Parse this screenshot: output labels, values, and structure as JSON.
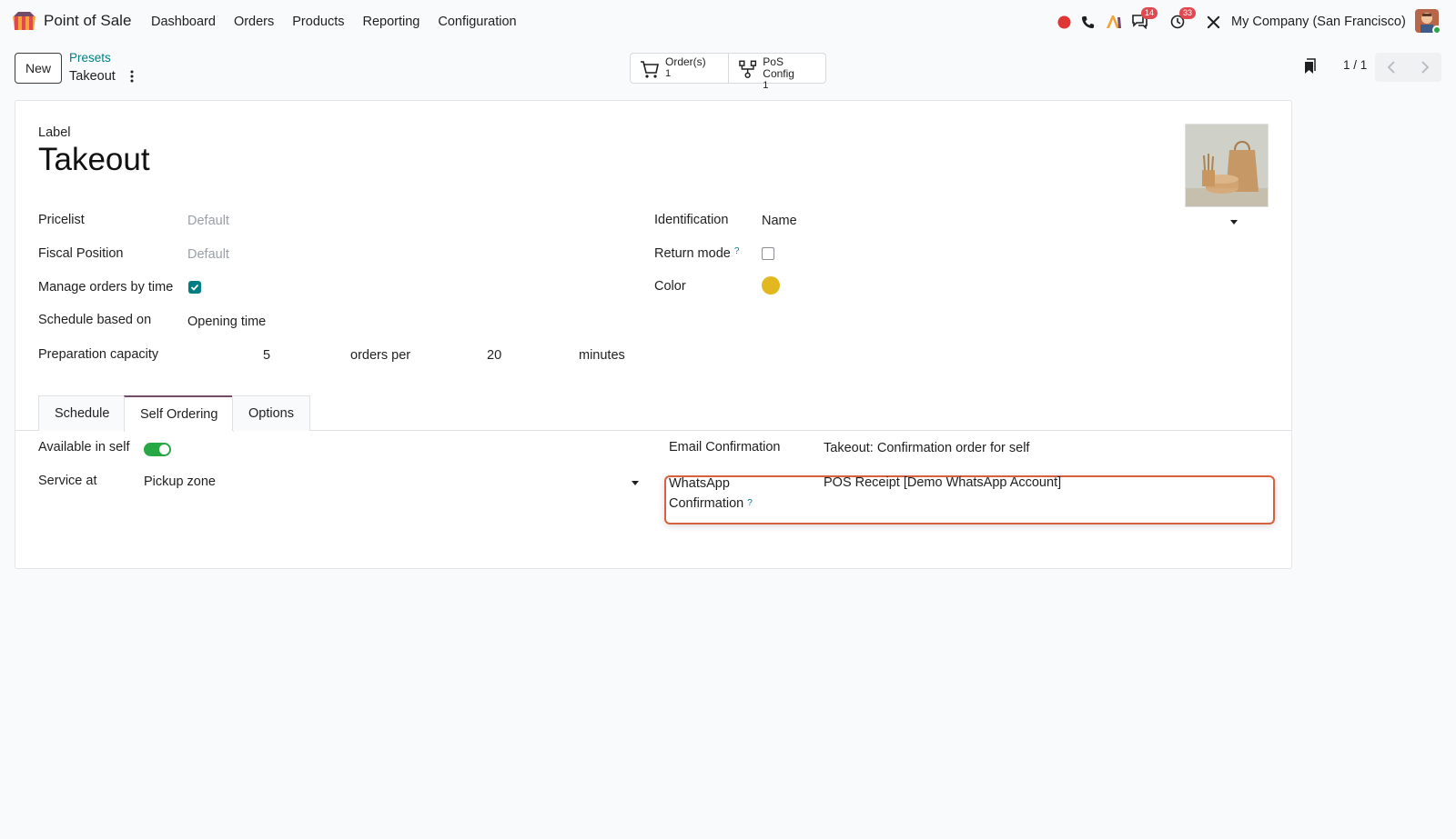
{
  "nav": {
    "app_name": "Point of Sale",
    "menu": [
      "Dashboard",
      "Orders",
      "Products",
      "Reporting",
      "Configuration"
    ],
    "messages_badge": "14",
    "activities_badge": "33",
    "company": "My Company (San Francisco)"
  },
  "control": {
    "new_label": "New",
    "breadcrumb_parent": "Presets",
    "breadcrumb_current": "Takeout",
    "stat_orders_label": "Order(s)",
    "stat_orders_value": "1",
    "stat_config_label": "PoS Config",
    "stat_config_value": "1",
    "pager": "1 / 1"
  },
  "form": {
    "label_caption": "Label",
    "title": "Takeout",
    "pricelist_label": "Pricelist",
    "pricelist_placeholder": "Default",
    "fiscal_label": "Fiscal Position",
    "fiscal_placeholder": "Default",
    "manage_label": "Manage orders by time",
    "manage_checked": true,
    "schedule_label": "Schedule based on",
    "schedule_value": "Opening time",
    "capacity_label": "Preparation capacity",
    "capacity_orders": "5",
    "capacity_orders_per": "orders per",
    "capacity_minutes_value": "20",
    "capacity_minutes": "minutes",
    "identification_label": "Identification",
    "identification_value": "Name",
    "return_label": "Return mode",
    "return_checked": false,
    "color_label": "Color",
    "color_value": "#e2b71f",
    "help_mark": "?"
  },
  "tabs": [
    "Schedule",
    "Self Ordering",
    "Options"
  ],
  "active_tab": "Self Ordering",
  "self_ordering": {
    "available_label": "Available in self",
    "available_on": true,
    "service_label": "Service at",
    "service_value": "Pickup zone",
    "email_label": "Email Confirmation",
    "email_value": "Takeout: Confirmation order for self",
    "whatsapp_label_1": "WhatsApp",
    "whatsapp_label_2": "Confirmation",
    "whatsapp_value": "POS Receipt [Demo WhatsApp Account]"
  },
  "colors": {
    "brand": "#714b67",
    "accent": "#017e84",
    "highlight": "#d9603d",
    "toggle": "#28a745"
  }
}
